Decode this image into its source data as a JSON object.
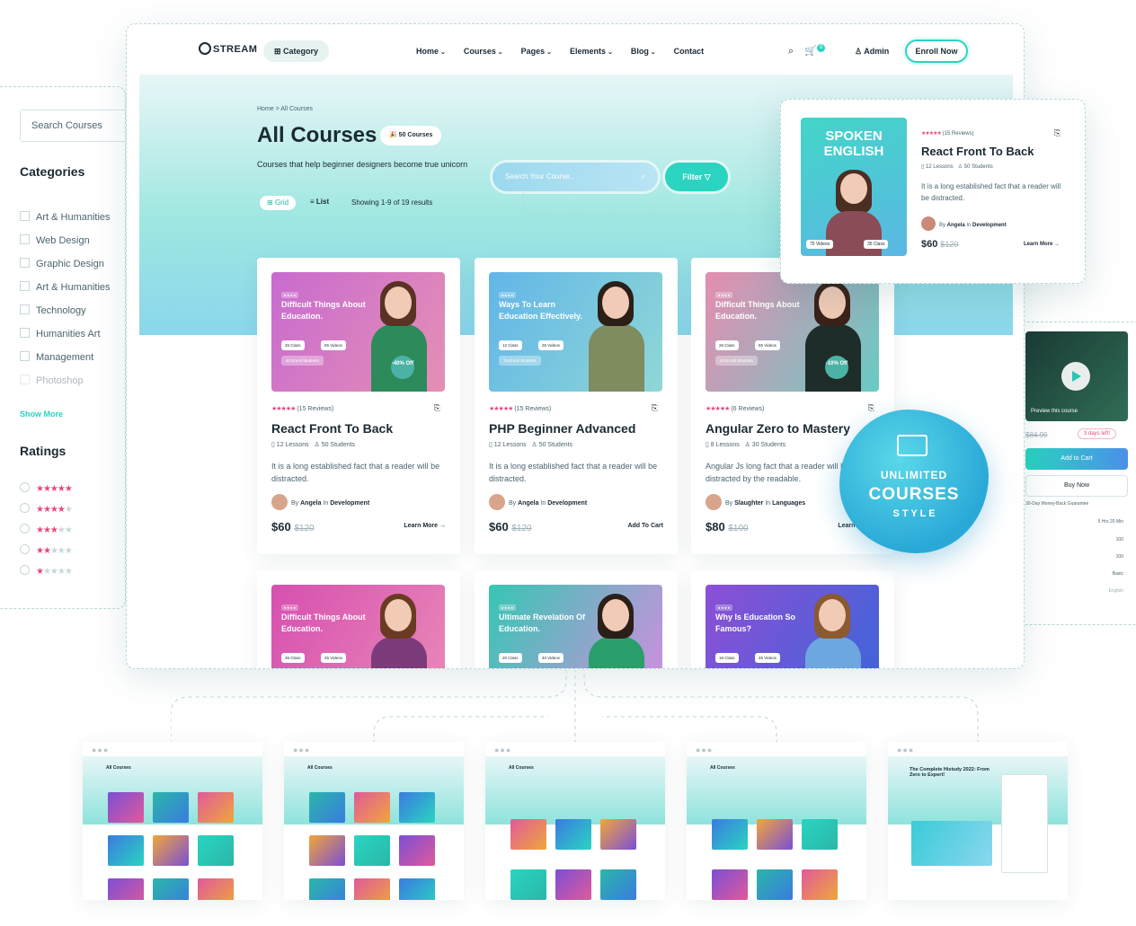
{
  "nav": {
    "logo": "STREAM",
    "category": "Category",
    "menu": [
      "Home",
      "Courses",
      "Pages",
      "Elements",
      "Blog",
      "Contact"
    ],
    "cart_count": "0",
    "admin": "Admin",
    "enroll": "Enroll Now"
  },
  "hero": {
    "breadcrumb": "Home  >  All Courses",
    "title": "All Courses",
    "count": "50 Courses",
    "subtitle": "Courses that help beginner designers become true unicorn",
    "grid": "Grid",
    "list": "List",
    "showing": "Showing 1-9 of 19 results",
    "search_placeholder": "Search Your Course..",
    "filter": "Filter"
  },
  "sidebar": {
    "search": "Search Courses",
    "categories_title": "Categories",
    "categories": [
      "Art & Humanities",
      "Web Design",
      "Graphic Design",
      "Art & Humanities",
      "Technology",
      "Humanities Art",
      "Management",
      "Photoshop"
    ],
    "show_more": "Show More",
    "ratings_title": "Ratings"
  },
  "cards": [
    {
      "thumb_title": "Difficult Things About Education.",
      "reviews": "(15 Reviews)",
      "title": "React Front To Back",
      "lessons": "12 Lessons",
      "students": "50 Students",
      "desc": "It is a long established fact that a reader will be distracted.",
      "author": "Angela",
      "cat": "Development",
      "price": "$60",
      "old": "$120",
      "action": "Learn More →",
      "off": "-40% Off",
      "chip1": "26 Class",
      "chip2": "65 Videos",
      "enroll": "40 Enroll Students",
      "c1": "#c86bd0",
      "c2": "#e58fb4",
      "body": "#2d8a5b",
      "hair": "#5a3224"
    },
    {
      "thumb_title": "Ways To Learn Education Effectively.",
      "reviews": "(15 Reviews)",
      "title": "PHP Beginner Advanced",
      "lessons": "12 Lessons",
      "students": "50 Students",
      "desc": "It is a long established fact that a reader will be distracted.",
      "author": "Angela",
      "cat": "Development",
      "price": "$60",
      "old": "$120",
      "action": "Add To Cart",
      "off": "",
      "chip1": "12 Class",
      "chip2": "25 Videos",
      "enroll": "75 Enroll Students",
      "c1": "#62b6e8",
      "c2": "#8fd7d6",
      "body": "#7e8c5f",
      "hair": "#2b1f18"
    },
    {
      "thumb_title": "Difficult Things About Education.",
      "reviews": "(6 Reviews)",
      "title": "Angular Zero to Mastery",
      "lessons": "8 Lessons",
      "students": "30 Students",
      "desc": "Angular Js long fact that a reader will be distracted by the readable.",
      "author": "Slaughter",
      "cat": "Languages",
      "price": "$80",
      "old": "$100",
      "action": "Learn More →",
      "off": "-10% Off",
      "chip1": "26 Class",
      "chip2": "65 Videos",
      "enroll": "40 Enroll Students",
      "c1": "#e58db0",
      "c2": "#68cbc4",
      "body": "#1f2d2a",
      "hair": "#3a2218"
    },
    {
      "thumb_title": "Difficult Things About Education.",
      "reviews": "",
      "title": "",
      "lessons": "",
      "students": "",
      "desc": "",
      "author": "",
      "cat": "",
      "price": "",
      "old": "",
      "action": "",
      "off": "",
      "chip1": "26 Class",
      "chip2": "45 Videos",
      "enroll": "",
      "c1": "#d74fb0",
      "c2": "#e98ab8",
      "body": "#7c3b7a",
      "hair": "#6b3a22"
    },
    {
      "thumb_title": "Ultimate Revelation Of Education.",
      "reviews": "",
      "title": "",
      "lessons": "",
      "students": "",
      "desc": "",
      "author": "",
      "cat": "",
      "price": "",
      "old": "",
      "action": "",
      "off": "",
      "chip1": "20 Class",
      "chip2": "40 Videos",
      "enroll": "",
      "c1": "#35c7b3",
      "c2": "#d68ce0",
      "body": "#2a9f6c",
      "hair": "#2b1f18"
    },
    {
      "thumb_title": "Why Is Education So Famous?",
      "reviews": "",
      "title": "",
      "lessons": "",
      "students": "",
      "desc": "",
      "author": "",
      "cat": "",
      "price": "",
      "old": "",
      "action": "",
      "off": "",
      "chip1": "18 Class",
      "chip2": "45 Videos",
      "enroll": "",
      "c1": "#8d4fd6",
      "c2": "#3b66d8",
      "body": "#6da7e0",
      "hair": "#8a5a30"
    }
  ],
  "popup": {
    "thumb_title": "SPOKEN ENGLISH",
    "videos": "75 Videos",
    "class": "35 Class",
    "reviews": "(15 Reviews)",
    "title": "React Front To Back",
    "lessons": "12 Lessons",
    "students": "50 Students",
    "desc": "It is a long established fact that a reader will be distracted.",
    "author": "Angela",
    "cat": "Development",
    "price": "$60",
    "old": "$120",
    "action": "Learn More →"
  },
  "right_panel": {
    "preview": "Preview this course",
    "old_price": "$84.99",
    "days": "3 days left!",
    "add_cart": "Add to Cart",
    "buy_now": "Buy Now",
    "guarantee": "30-Day Money-Back Guarantee",
    "rows": [
      "5 Hrs 20 Min",
      "100",
      "100",
      "Basic",
      "English"
    ]
  },
  "badge": {
    "l1": "UNLIMITED",
    "l2": "COURSES",
    "l3": "S T Y L E"
  },
  "thumbnails": [
    {
      "title": "All Courses"
    },
    {
      "title": "All Courses"
    },
    {
      "title": "All Courses"
    },
    {
      "title": "All Courses"
    },
    {
      "title": "The Complete Histudy 2022: From Zero to Expert!"
    }
  ],
  "colors": {
    "accent": "#2ad4c1",
    "star": "#e5487a"
  }
}
